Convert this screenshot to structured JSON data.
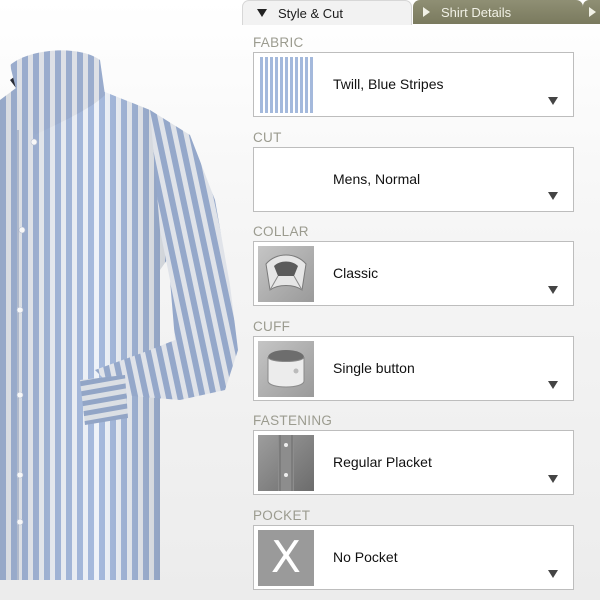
{
  "tabs": {
    "style_cut": "Style & Cut",
    "shirt_details": "Shirt Details"
  },
  "options": [
    {
      "key": "fabric",
      "label": "FABRIC",
      "value": "Twill, Blue Stripes",
      "thumb": "fabric-swatch"
    },
    {
      "key": "cut",
      "label": "CUT",
      "value": "Mens, Normal",
      "thumb": "none"
    },
    {
      "key": "collar",
      "label": "COLLAR",
      "value": "Classic",
      "thumb": "collar-image"
    },
    {
      "key": "cuff",
      "label": "CUFF",
      "value": "Single button",
      "thumb": "cuff-image"
    },
    {
      "key": "fastening",
      "label": "FASTENING",
      "value": "Regular Placket",
      "thumb": "placket-image"
    },
    {
      "key": "pocket",
      "label": "POCKET",
      "value": "No Pocket",
      "thumb": "no-pocket-icon"
    }
  ],
  "icons": {
    "tab_active": "triangle-down-icon",
    "tab_inactive": "triangle-right-icon",
    "dropdown": "dropdown-arrow-icon",
    "no_pocket": "X"
  },
  "colors": {
    "fabric_blue": "#a4b9dc",
    "tab_olive": "#7f7f63",
    "label_gray": "#9b9b8f"
  }
}
